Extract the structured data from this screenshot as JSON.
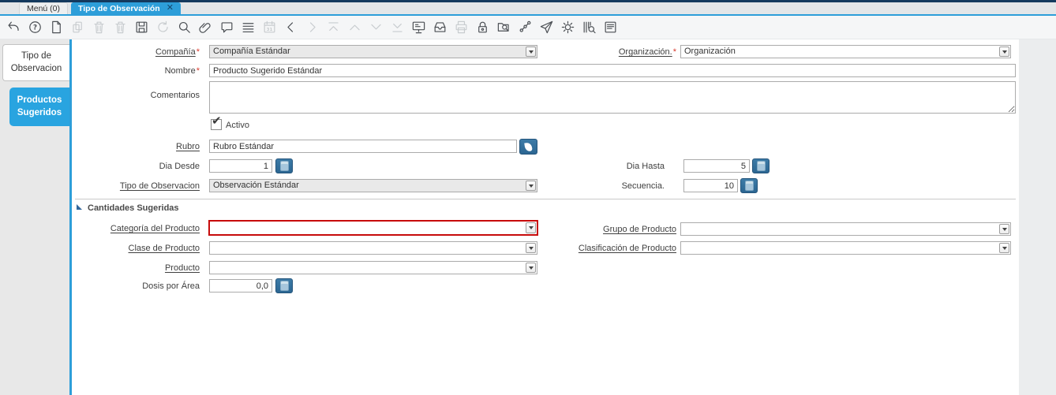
{
  "tabbar": {
    "menu_tab": "Menú (0)",
    "active_tab": "Tipo de Observación",
    "close_glyph": "✕"
  },
  "toolbar": {
    "icons": [
      {
        "name": "undo",
        "enabled": true
      },
      {
        "name": "help",
        "enabled": true
      },
      {
        "name": "new-record",
        "enabled": true
      },
      {
        "name": "copy-record",
        "enabled": false
      },
      {
        "name": "delete-record",
        "enabled": false
      },
      {
        "name": "delete-selection",
        "enabled": false
      },
      {
        "name": "save",
        "enabled": true
      },
      {
        "name": "refresh",
        "enabled": false
      },
      {
        "name": "find",
        "enabled": true
      },
      {
        "name": "attachment",
        "enabled": true
      },
      {
        "name": "chat",
        "enabled": true
      },
      {
        "name": "grid-toggle",
        "enabled": true
      },
      {
        "name": "calendar",
        "enabled": false
      },
      {
        "name": "previous-record",
        "enabled": true
      },
      {
        "name": "next-record",
        "enabled": false
      },
      {
        "name": "first-record",
        "enabled": false
      },
      {
        "name": "parent-record",
        "enabled": false
      },
      {
        "name": "detail-record",
        "enabled": false
      },
      {
        "name": "last-record",
        "enabled": false
      },
      {
        "name": "report",
        "enabled": true
      },
      {
        "name": "archive",
        "enabled": true
      },
      {
        "name": "print",
        "enabled": false
      },
      {
        "name": "lock",
        "enabled": true
      },
      {
        "name": "zoom-across",
        "enabled": true
      },
      {
        "name": "workflow",
        "enabled": true
      },
      {
        "name": "request",
        "enabled": true
      },
      {
        "name": "preferences",
        "enabled": true
      },
      {
        "name": "product-info",
        "enabled": true
      },
      {
        "name": "report-design",
        "enabled": true
      }
    ]
  },
  "sidebar": {
    "tabs": [
      {
        "label": "Tipo de Observacion",
        "active": false
      },
      {
        "label": "Productos Sugeridos",
        "active": true
      }
    ]
  },
  "form": {
    "compania": {
      "label": "Compañía",
      "required": "*",
      "value": "Compañía Estándar"
    },
    "organizacion": {
      "label": "Organización.",
      "required": "*",
      "value": "Organización"
    },
    "nombre": {
      "label": "Nombre",
      "required": "*",
      "value": "Producto Sugerido Estándar"
    },
    "comentarios": {
      "label": "Comentarios",
      "value": ""
    },
    "activo": {
      "label": "Activo",
      "checked": true,
      "check_glyph": "✔"
    },
    "rubro": {
      "label": "Rubro",
      "value": "Rubro Estándar"
    },
    "dia_desde": {
      "label": "Dia Desde",
      "value": "1"
    },
    "dia_hasta": {
      "label": "Dia Hasta",
      "value": "5"
    },
    "tipo_observacion": {
      "label": "Tipo de Observacion",
      "value": "Observación Estándar"
    },
    "secuencia": {
      "label": "Secuencia.",
      "value": "10"
    },
    "section_cantidades": {
      "title": "Cantidades Sugeridas"
    },
    "categoria_producto": {
      "label": "Categoría del Producto",
      "value": ""
    },
    "grupo_producto": {
      "label": "Grupo de Producto",
      "value": ""
    },
    "clase_producto": {
      "label": "Clase de Producto",
      "value": ""
    },
    "clasificacion_producto": {
      "label": "Clasificación de Producto",
      "value": ""
    },
    "producto": {
      "label": "Producto",
      "value": ""
    },
    "dosis_area": {
      "label": "Dosis por Área",
      "value": "0,0"
    }
  },
  "colors": {
    "top_navy": "#143a5e",
    "accent_blue": "#2d9ed9",
    "sidebar_active_blue": "#29a4e0",
    "button_blue": "#2f6d99",
    "highlight_red": "#c70b0b",
    "required_red": "#d83a2e"
  }
}
